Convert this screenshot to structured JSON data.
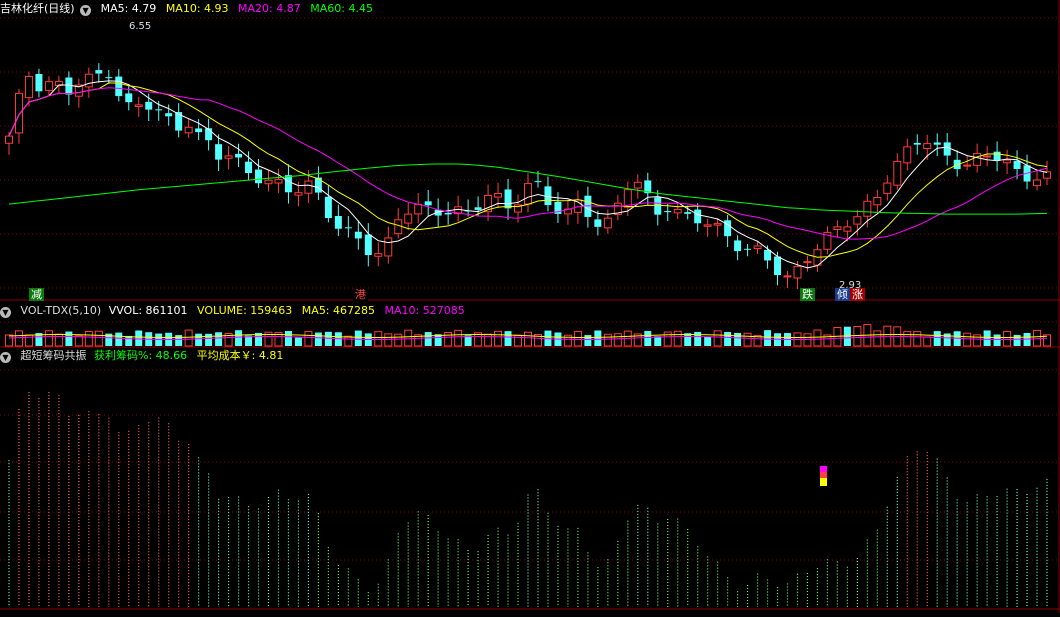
{
  "main": {
    "title": "吉林化纤(日线)",
    "ma5": "MA5: 4.79",
    "ma10": "MA10: 4.93",
    "ma20": "MA20: 4.87",
    "ma60": "MA60: 4.45",
    "high_label": "6.55",
    "low_label": "2.93",
    "markers": [
      {
        "text": "减",
        "bg": "#0a7a0a",
        "color": "#ffffff"
      },
      {
        "text": "港",
        "bg": "#000000",
        "color": "#ff4040"
      },
      {
        "text": "跌",
        "bg": "#0a7a0a",
        "color": "#ffffff"
      },
      {
        "text": "倾",
        "bg": "#1a3a8a",
        "color": "#ffffff"
      },
      {
        "text": "涨",
        "bg": "#a00000",
        "color": "#ffffff"
      }
    ]
  },
  "volume": {
    "name": "VOL-TDX(5,10)",
    "vvol": "VVOL: 861101",
    "volume": "VOLUME: 159463",
    "ma5": "MA5: 467285",
    "ma10": "MA10: 527085"
  },
  "chips": {
    "name": "超短筹码共振",
    "profit": "获利筹码%: 48.66",
    "avgcost": "平均成本￥: 4.81"
  },
  "colors": {
    "up": "#ff3c3c",
    "down": "#54ffff",
    "ma5": "#ffffff",
    "ma10": "#ffff00",
    "ma20": "#ff00ff",
    "ma60": "#00ff00",
    "grid": "#8b0000"
  },
  "chart_data": {
    "type": "candlestick",
    "ylim": [
      2.9,
      6.7
    ],
    "ma60": [
      4.1,
      4.15,
      4.2,
      4.25,
      4.3,
      4.34,
      4.38,
      4.42,
      4.46,
      4.5,
      4.55,
      4.6,
      4.64,
      4.66,
      4.66,
      4.62,
      4.55,
      4.48,
      4.4,
      4.32,
      4.25,
      4.2,
      4.15,
      4.1,
      4.05,
      4.02,
      4.0,
      3.98,
      3.97,
      3.96,
      3.96,
      3.96,
      3.97
    ],
    "close": [
      5.0,
      5.6,
      6.0,
      5.7,
      5.9,
      5.6,
      5.75,
      5.8,
      5.9,
      6.0,
      5.6,
      5.4,
      5.5,
      5.4,
      5.3,
      5.2,
      5.3,
      5.05,
      4.9,
      4.7,
      4.8,
      4.6,
      4.55,
      4.45,
      4.35,
      4.25,
      4.3,
      4.4,
      4.2,
      3.9,
      3.7,
      3.6,
      3.45,
      3.4,
      3.6,
      4.0,
      4.05,
      4.0,
      3.95,
      4.0,
      4.05,
      4.0,
      4.1,
      4.2,
      4.1,
      4.0,
      4.3,
      4.5,
      4.2,
      4.0,
      3.9,
      4.1,
      4.0,
      3.8,
      3.9,
      4.3,
      4.4,
      4.2,
      4.0,
      4.1,
      4.0,
      3.9,
      3.85,
      3.75,
      3.7,
      3.6,
      3.5,
      3.45,
      3.3,
      3.1,
      3.0,
      3.3,
      3.5,
      3.6,
      3.7,
      3.8,
      3.9,
      4.1,
      4.3,
      4.6,
      4.7,
      4.9,
      5.0,
      4.9,
      4.8,
      4.7,
      4.65,
      4.7,
      4.75,
      4.79,
      4.6,
      4.5,
      4.5,
      4.45
    ],
    "bars": 99
  }
}
